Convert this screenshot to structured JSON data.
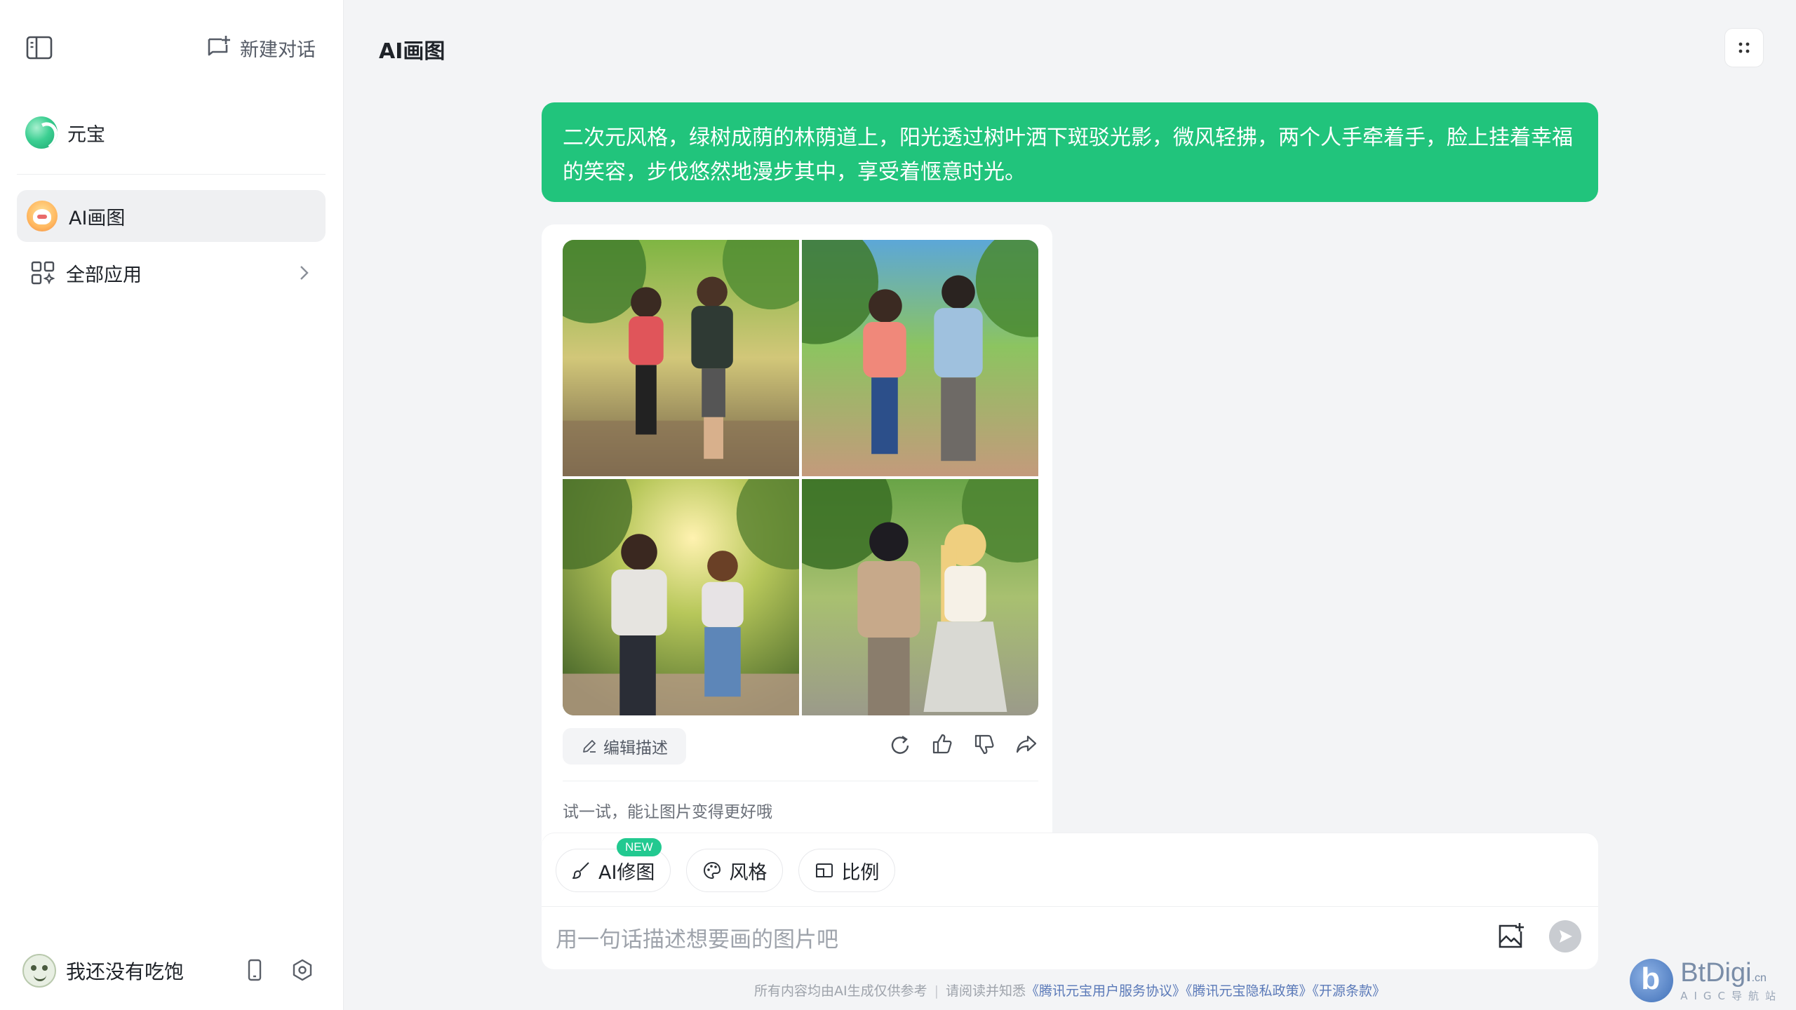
{
  "sidebar": {
    "new_chat_label": "新建对话",
    "brand_name": "元宝",
    "items": [
      {
        "label": "AI画图",
        "active": true
      },
      {
        "label": "全部应用",
        "active": false
      }
    ],
    "user_name": "我还没有吃饱"
  },
  "header": {
    "title": "AI画图"
  },
  "conversation": {
    "user_message": "二次元风格，绿树成荫的林荫道上，阳光透过树叶洒下斑驳光影，微风轻拂，两个人手牵着手，脸上挂着幸福的笑容，步伐悠然地漫步其中，享受着惬意时光。",
    "result": {
      "edit_label": "编辑描述",
      "try_text": "试一试，能让图片变得更好哦"
    }
  },
  "composer": {
    "tools": [
      {
        "label": "AI修图",
        "badge": "NEW"
      },
      {
        "label": "风格"
      },
      {
        "label": "比例"
      }
    ],
    "placeholder": "用一句话描述想要画的图片吧"
  },
  "footer": {
    "disclaimer": "所有内容均由AI生成仅供参考",
    "notice": "请阅读并知悉",
    "links": "《腾讯元宝用户服务协议》《腾讯元宝隐私政策》《开源条款》"
  },
  "watermark": {
    "title": "BtDigi",
    "suffix": ".cn",
    "subtitle": "AIGC导航站"
  },
  "colors": {
    "accent": "#21c47c",
    "badge": "#22c990",
    "link": "#5a79b8"
  }
}
